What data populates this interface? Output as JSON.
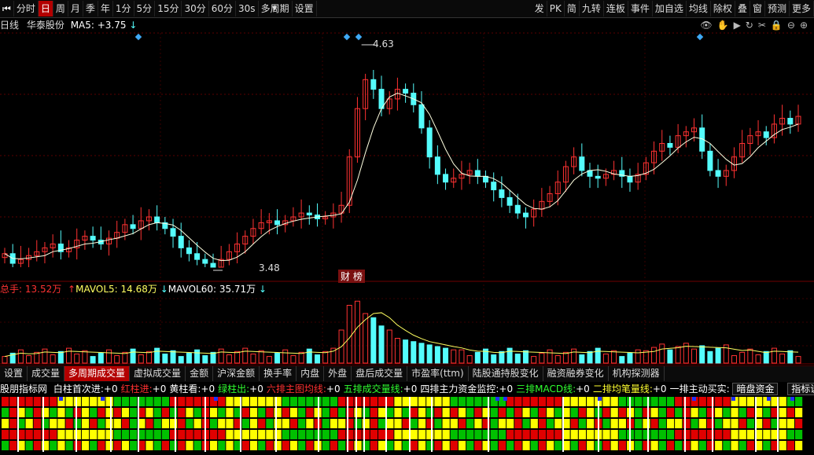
{
  "toolbar": {
    "left_items": [
      {
        "label": "分时"
      },
      {
        "label": "日",
        "active": true
      },
      {
        "label": "周"
      },
      {
        "label": "月"
      },
      {
        "label": "季"
      },
      {
        "label": "年"
      },
      {
        "label": "1分"
      },
      {
        "label": "5分"
      },
      {
        "label": "15分"
      },
      {
        "label": "30分"
      },
      {
        "label": "60分"
      },
      {
        "label": "30s"
      },
      {
        "label": "多周期"
      },
      {
        "label": "设置"
      }
    ],
    "right_items": [
      {
        "label": "发"
      },
      {
        "label": "PK"
      },
      {
        "label": "简"
      },
      {
        "label": "九转"
      },
      {
        "label": "连板"
      },
      {
        "label": "事件"
      },
      {
        "label": "加自选"
      },
      {
        "label": "均线"
      },
      {
        "label": "除权"
      },
      {
        "label": "叠"
      },
      {
        "label": "窗"
      },
      {
        "label": "预测"
      },
      {
        "label": "更多"
      }
    ]
  },
  "chart_header": {
    "period": "日线",
    "stock_name": "华泰股份",
    "ma_label": "MA5: +3.75",
    "ma_arrow": "↓"
  },
  "price_labels": {
    "high": "4.63",
    "low": "3.48",
    "event": "财 榜"
  },
  "volume_header": {
    "total": "总手: 13.52万",
    "mavol5": "MAVOL5: 14.68万",
    "mavol5_arrow": "↑",
    "mavol60": "MAVOL60: 35.71万",
    "mavol60_arrow": "↓"
  },
  "tabs": [
    {
      "label": "设置"
    },
    {
      "label": "成交量"
    },
    {
      "label": "多周期成交量",
      "active": true
    },
    {
      "label": "虚拟成交量"
    },
    {
      "label": "金额"
    },
    {
      "label": "沪深金额"
    },
    {
      "label": "换手率"
    },
    {
      "label": "内盘"
    },
    {
      "label": "外盘"
    },
    {
      "label": "盘后成交量"
    },
    {
      "label": "市盈率(ttm)"
    },
    {
      "label": "陆股通持股变化"
    },
    {
      "label": "融资融券变化"
    },
    {
      "label": "机构探测器"
    }
  ],
  "indicator_line": {
    "title": "股朋指标网",
    "items": [
      {
        "label": "白柱首次进:",
        "value": "+0",
        "color": "#ffffff"
      },
      {
        "label": "红柱进:",
        "value": "+0",
        "color": "#ff3030"
      },
      {
        "label": "黄柱看:",
        "value": "+0",
        "color": "#ffffff"
      },
      {
        "label": "绿柱出:",
        "value": "+0",
        "color": "#30ff30"
      },
      {
        "label": "六排主图均线:",
        "value": "+0",
        "color": "#ff3030"
      },
      {
        "label": "五排成交量线:",
        "value": "+0",
        "color": "#30ff30"
      },
      {
        "label": "四排主力资金监控:",
        "value": "+0",
        "color": "#ffffff"
      },
      {
        "label": "三排MACD线:",
        "value": "+0",
        "color": "#30ff30"
      },
      {
        "label": "二排均笔量线:",
        "value": "+0",
        "color": "#ffff30"
      },
      {
        "label": "一排主动买实:",
        "value": "",
        "color": "#ffffff"
      }
    ],
    "button1": "暗盘资金",
    "button2": "指标说明"
  },
  "colors": {
    "up": "#ff3232",
    "down": "#54fcfc",
    "ma": "#ffffe0",
    "accent": "#b30000"
  },
  "chart_data": {
    "type": "candlestick",
    "y_high": 4.63,
    "y_low": 3.48,
    "close_seq": [
      3.55,
      3.5,
      3.52,
      3.54,
      3.56,
      3.58,
      3.6,
      3.56,
      3.58,
      3.62,
      3.64,
      3.62,
      3.6,
      3.63,
      3.66,
      3.7,
      3.68,
      3.72,
      3.74,
      3.71,
      3.68,
      3.64,
      3.58,
      3.55,
      3.52,
      3.5,
      3.48,
      3.52,
      3.56,
      3.6,
      3.64,
      3.68,
      3.71,
      3.72,
      3.7,
      3.72,
      3.74,
      3.76,
      3.75,
      3.73,
      3.74,
      3.76,
      3.8,
      4.05,
      4.3,
      4.45,
      4.4,
      4.3,
      4.35,
      4.4,
      4.38,
      4.32,
      4.2,
      4.05,
      3.96,
      3.92,
      3.94,
      3.96,
      3.98,
      3.95,
      3.92,
      3.88,
      3.84,
      3.8,
      3.76,
      3.74,
      3.78,
      3.82,
      3.86,
      3.92,
      4.0,
      4.05,
      3.98,
      3.95,
      3.94,
      3.96,
      3.98,
      3.95,
      3.92,
      3.96,
      4.02,
      4.08,
      4.12,
      4.1,
      4.16,
      4.18,
      4.2,
      4.08,
      3.98,
      3.95,
      3.98,
      4.05,
      4.12,
      4.16,
      4.18,
      4.15,
      4.22,
      4.25,
      4.22,
      4.26
    ]
  }
}
